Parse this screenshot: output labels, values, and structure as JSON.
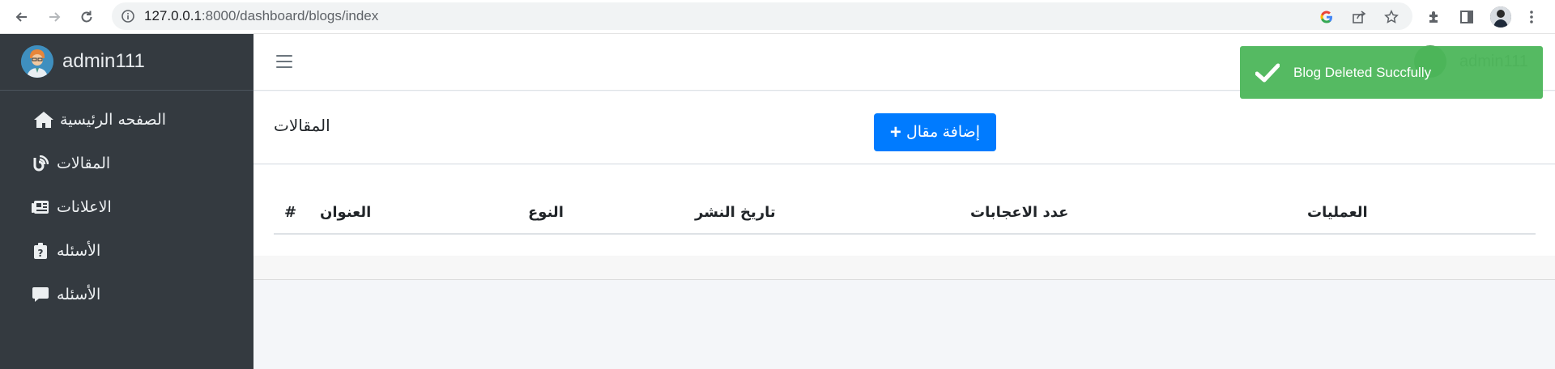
{
  "browser": {
    "url_host": "127.0.0.1",
    "url_path": ":8000/dashboard/blogs/index"
  },
  "sidebar": {
    "brand_name": "admin111",
    "items": [
      {
        "label": "الصفحه الرئيسية",
        "icon": "home-icon"
      },
      {
        "label": "المقالات",
        "icon": "blog-icon"
      },
      {
        "label": "الاعلانات",
        "icon": "newspaper-icon"
      },
      {
        "label": "الأسئله",
        "icon": "question-clipboard-icon"
      },
      {
        "label": "الأسئله",
        "icon": "comment-icon"
      }
    ]
  },
  "topbar": {
    "user_name": "admin111"
  },
  "content_header": {
    "title": "المقالات",
    "add_button_label": "إضافة مقال"
  },
  "table": {
    "headers": {
      "hash": "#",
      "title": "العنوان",
      "type": "النوع",
      "publish_date": "تاريخ النشر",
      "likes": "عدد الاعجابات",
      "actions": "العمليات"
    }
  },
  "toast": {
    "message": "Blog Deleted Succfully"
  },
  "colors": {
    "sidebar_bg": "#343a40",
    "primary": "#007bff",
    "toast_success": "#4cb65a"
  }
}
